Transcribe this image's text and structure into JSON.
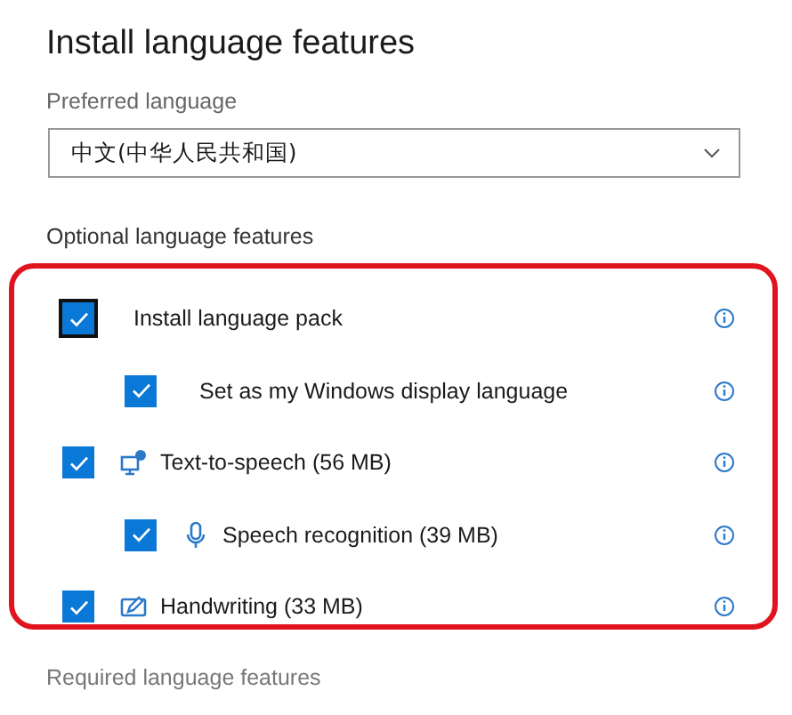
{
  "title": "Install language features",
  "preferred_language": {
    "label": "Preferred language",
    "value": "中文(中华人民共和国)"
  },
  "optional_features": {
    "heading": "Optional language features",
    "items": [
      {
        "label": "Install language pack",
        "checked": true,
        "focused": true,
        "kind": "plain",
        "children": [
          {
            "label": "Set as my Windows display language",
            "checked": true,
            "focused": false,
            "kind": "plain"
          }
        ]
      },
      {
        "label": "Text-to-speech (56 MB)",
        "checked": true,
        "focused": false,
        "kind": "speech",
        "children": [
          {
            "label": "Speech recognition (39 MB)",
            "checked": true,
            "focused": false,
            "kind": "mic"
          }
        ]
      },
      {
        "label": "Handwriting (33 MB)",
        "checked": true,
        "focused": false,
        "kind": "pen"
      }
    ]
  },
  "required_features": {
    "heading": "Required language features"
  }
}
